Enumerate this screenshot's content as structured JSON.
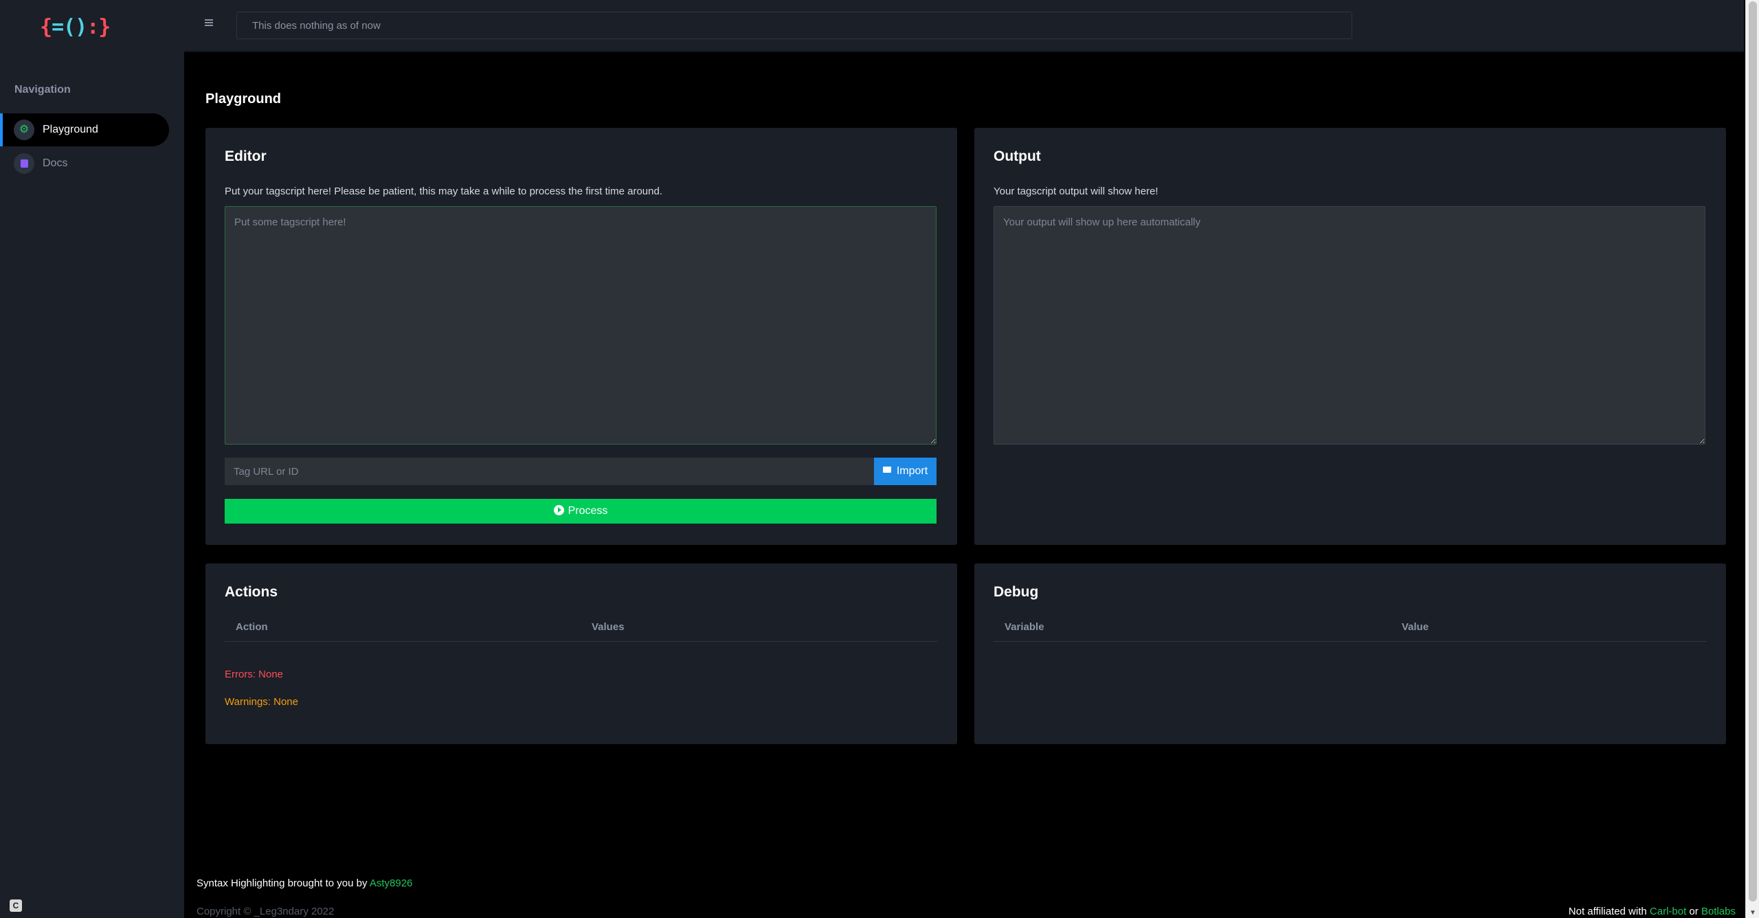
{
  "brand": {
    "logo_left": "{",
    "logo_middle": "=()",
    "logo_right": ":}"
  },
  "sidebar": {
    "heading": "Navigation",
    "items": [
      {
        "label": "Playground",
        "icon": "gear-icon",
        "active": true
      },
      {
        "label": "Docs",
        "icon": "book-icon",
        "active": false
      }
    ]
  },
  "header": {
    "search_placeholder": "This does nothing as of now"
  },
  "page": {
    "title": "Playground"
  },
  "editor": {
    "title": "Editor",
    "subtitle": "Put your tagscript here! Please be patient, this may take a while to process the first time around.",
    "placeholder": "Put some tagscript here!",
    "tag_input_placeholder": "Tag URL or ID",
    "import_label": "Import",
    "process_label": "Process"
  },
  "output": {
    "title": "Output",
    "subtitle": "Your tagscript output will show here!",
    "placeholder": "Your output will show up here automatically"
  },
  "actions": {
    "title": "Actions",
    "columns": [
      "Action",
      "Values"
    ],
    "errors_text": "Errors: None",
    "warnings_text": "Warnings: None"
  },
  "debug": {
    "title": "Debug",
    "columns": [
      "Variable",
      "Value"
    ]
  },
  "footer": {
    "credit_prefix": "Syntax Highlighting brought to you by ",
    "credit_name": "Asty8926",
    "copyright": "Copyright © _Leg3ndary 2022",
    "affiliation_prefix": "Not affiliated with ",
    "affiliation_link1": "Carl-bot",
    "affiliation_mid": " or ",
    "affiliation_link2": "Botlabs"
  },
  "colors": {
    "accent_blue": "#1e88e5",
    "process_green": "#00cc5a",
    "error_red": "#ff4d5a",
    "warning_orange": "#f59e0b",
    "link_green": "#22c55e",
    "panel_bg": "#1b1f27"
  }
}
